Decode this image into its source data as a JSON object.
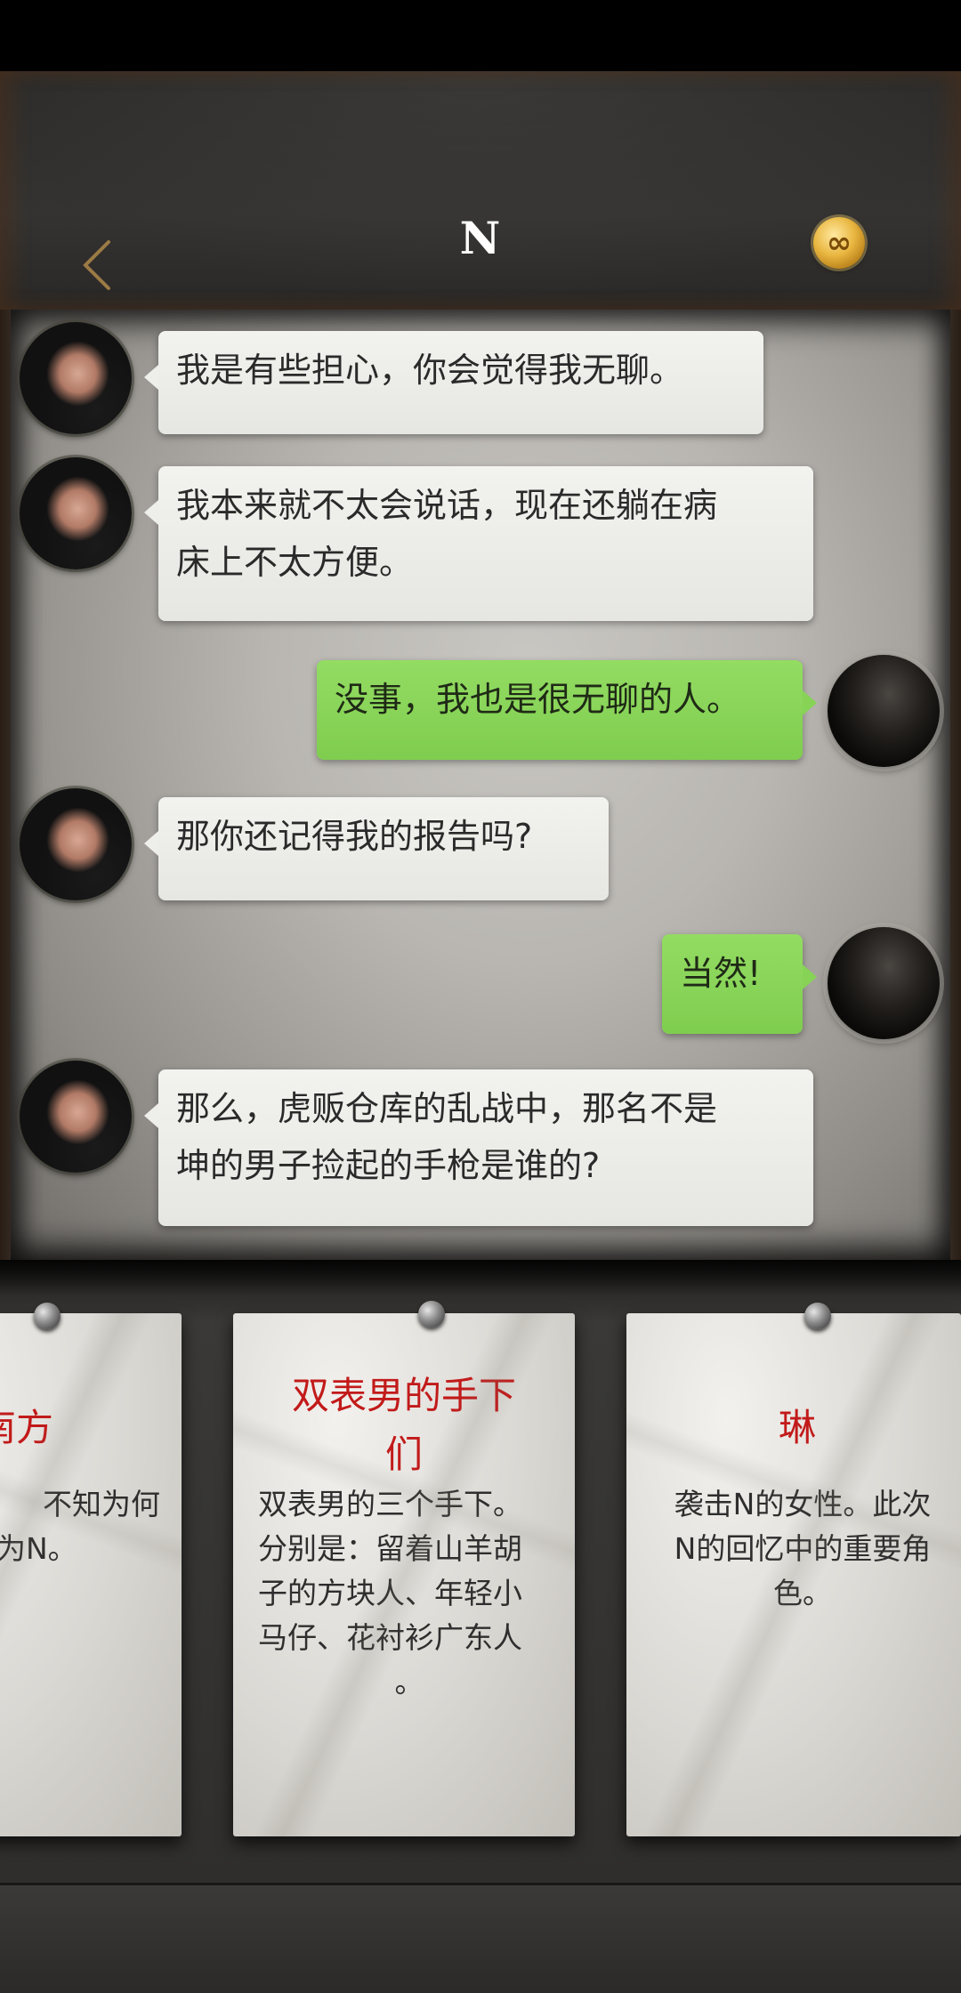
{
  "header": {
    "title": "N",
    "coin_symbol": "∞"
  },
  "messages": [
    {
      "side": "left",
      "text_lines": [
        "我是有些担心，你会觉得我无聊。"
      ]
    },
    {
      "side": "left",
      "text_lines": [
        "我本来就不太会说话，现在还躺在病",
        "床上不太方便。"
      ]
    },
    {
      "side": "right",
      "text_lines": [
        "没事，我也是很无聊的人。"
      ]
    },
    {
      "side": "left",
      "text_lines": [
        "那你还记得我的报告吗?"
      ]
    },
    {
      "side": "right",
      "text_lines": [
        "当然!"
      ]
    },
    {
      "side": "left",
      "text_lines": [
        "那么，虎贩仓库的乱战中，那名不是",
        "坤的男子捡起的手枪是谁的?"
      ]
    }
  ],
  "cards": [
    {
      "title_lines": [
        "南方"
      ],
      "desc_lines": [
        "不知为何",
        "为N。"
      ]
    },
    {
      "title_lines": [
        "双表男的手下",
        "们"
      ],
      "desc_lines": [
        "双表男的三个手下。",
        "分别是：留着山羊胡",
        "子的方块人、年轻小",
        "马仔、花衬衫广东人",
        "。"
      ]
    },
    {
      "title_lines": [
        "琳"
      ],
      "desc_lines": [
        "袭击N的女性。此次",
        "N的回忆中的重要角",
        "色。"
      ]
    }
  ],
  "colors": {
    "green_bubble": "#86d356",
    "white_bubble": "#eeeeea",
    "card_title": "#c21a1a"
  }
}
